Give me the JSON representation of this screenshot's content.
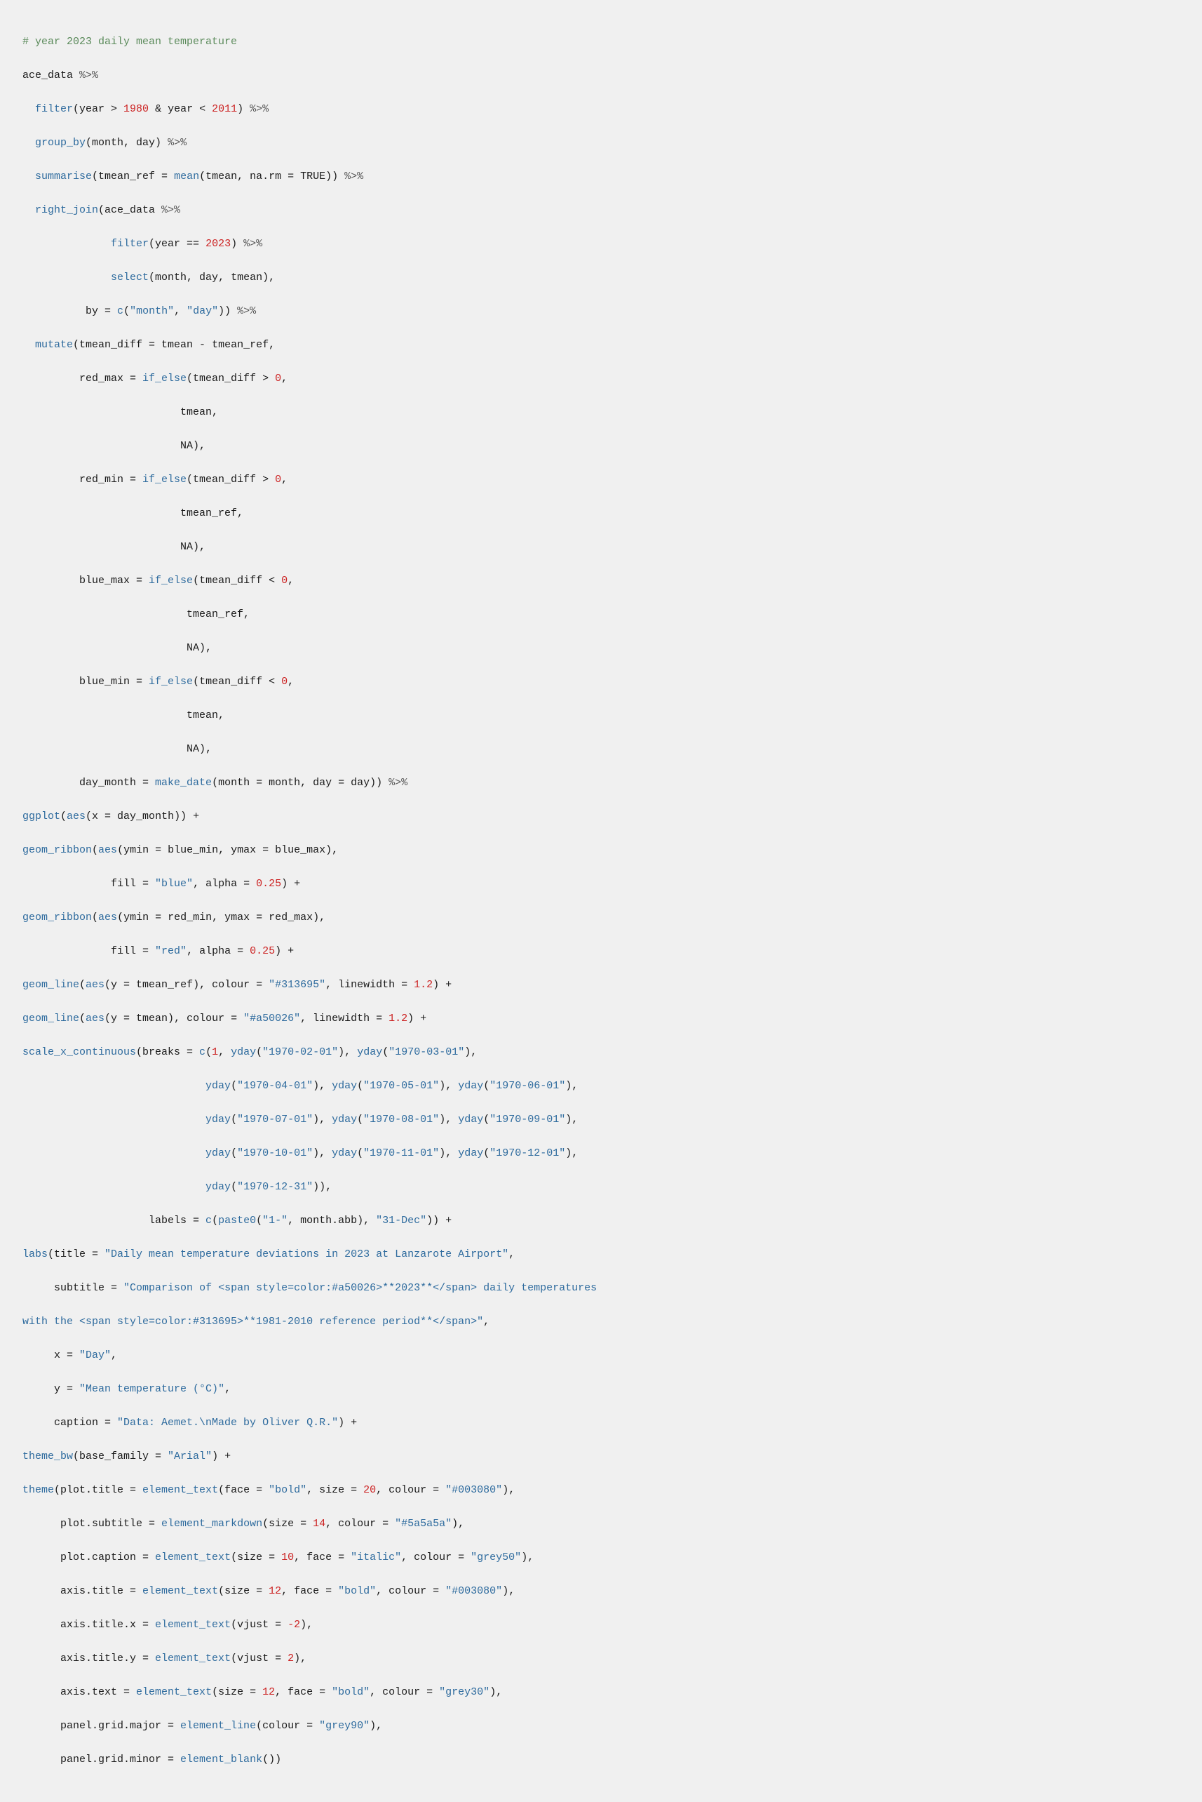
{
  "code": {
    "comment": "# year 2023 daily mean temperature",
    "lines": []
  }
}
